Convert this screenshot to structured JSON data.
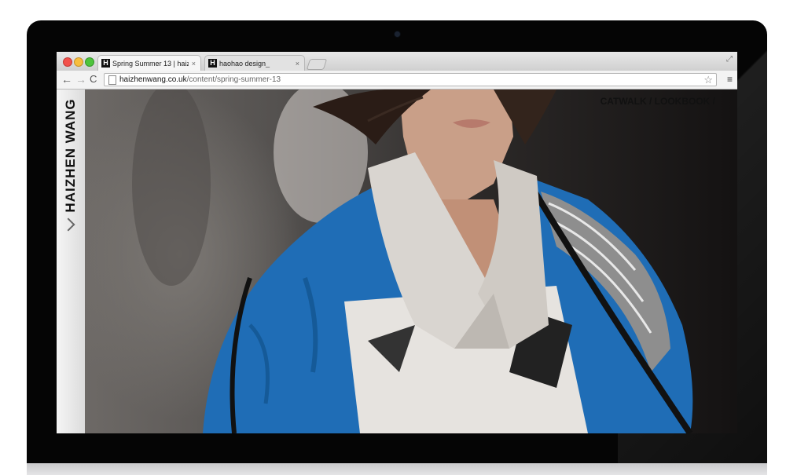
{
  "browser": {
    "tabs": [
      {
        "favicon": "H",
        "title": "Spring Summer 13 | haizh",
        "close": "×"
      },
      {
        "favicon": "H",
        "title": "haohao design_",
        "close": "×"
      }
    ],
    "toolbar": {
      "back": "←",
      "forward": "→",
      "reload": "C",
      "url_domain": "haizhenwang.co.uk",
      "url_path": "/content/spring-summer-13",
      "star": "☆",
      "menu": "≡"
    },
    "fullscreen_icon": "⤢"
  },
  "page": {
    "brand": "HAIZHEN WANG",
    "nav_text": "CATWALK / LOOKBOOK /"
  },
  "colors": {
    "jacket_blue": "#1f6db6",
    "collar": "#d9d5d0",
    "background": "#1a1717"
  },
  "icons": [
    "back-arrow-icon",
    "forward-arrow-icon",
    "reload-icon",
    "page-icon",
    "star-icon",
    "menu-icon",
    "chevron-right-icon",
    "fullscreen-icon"
  ]
}
